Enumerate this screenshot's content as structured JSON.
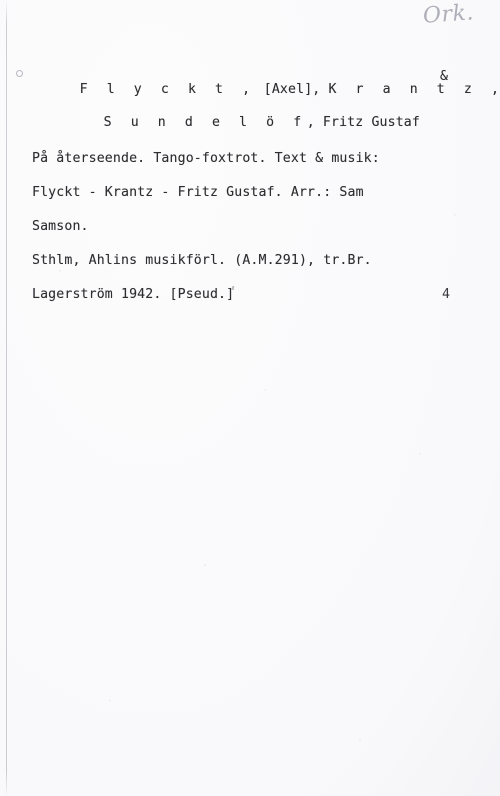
{
  "card": {
    "type": "library-catalog-card",
    "background_color": "#fcfcfd",
    "text_color": "#2e2e30",
    "annotation_color": "#a9a9b4"
  },
  "annotation": {
    "handwritten_note": "Ork."
  },
  "margin": {
    "mark": "°"
  },
  "heading": {
    "line_1_main": "F l y c k t ,",
    "line_1_bracket": " [Axel], ",
    "line_1_surname2": "K r a n t z ,",
    "ampersand": "&",
    "line_1_full": "F l y c k t, [Axel], K r a n t z,            &",
    "line_2_spaced": "S u n d e l ö f",
    "line_2_rest": ", Fritz Gustaf",
    "line_2_full": "S u n d e l ö f, Fritz Gustaf"
  },
  "body": {
    "lines": [
      "På återseende. Tango-foxtrot. Text & musik:",
      "Flyckt - Krantz - Fritz Gustaf. Arr.: Sam",
      "Samson.",
      "Sthlm, Ahlins musikförl. (A.M.291), tr.Br.",
      "Lagerström 1942. [Pseud.]"
    ],
    "title": "På återseende",
    "genre": "Tango-foxtrot",
    "text_and_music_credit": "Text & musik: Flyckt - Krantz - Fritz Gustaf",
    "arranger": "Arr.: Sam Samson",
    "place": "Sthlm",
    "publisher": "Ahlins musikförl.",
    "plate_number": "(A.M.291)",
    "printer": "tr.Br. Lagerström",
    "year": "1942",
    "note": "[Pseud.]"
  },
  "page_number": "4"
}
